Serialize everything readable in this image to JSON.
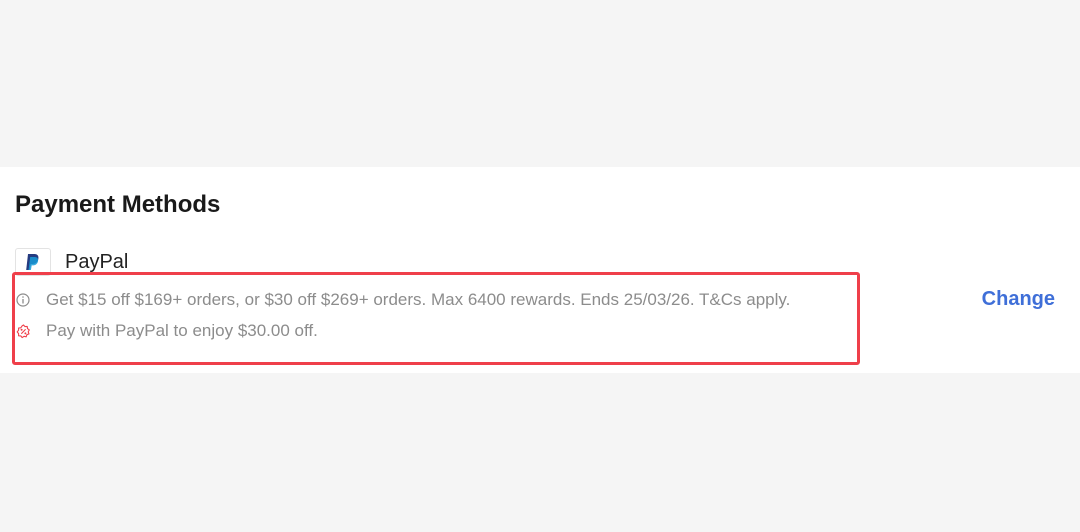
{
  "payment": {
    "title": "Payment Methods",
    "method_name": "PayPal",
    "change_label": "Change",
    "promos": [
      "Get $15 off $169+ orders, or $30 off $269+ orders. Max 6400 rewards. Ends 25/03/26. T&Cs apply.",
      "Pay with PayPal to enjoy $30.00 off."
    ],
    "icons": {
      "method": "paypal-logo-icon",
      "promo_info": "info-icon",
      "promo_discount": "discount-icon"
    },
    "colors": {
      "link": "#3f6fd8",
      "highlight_border": "#ef3f4a",
      "promo_text": "#8c8c8c",
      "discount_icon": "#ef3f4a",
      "paypal_dark": "#253b80",
      "paypal_light": "#179bd7"
    }
  }
}
